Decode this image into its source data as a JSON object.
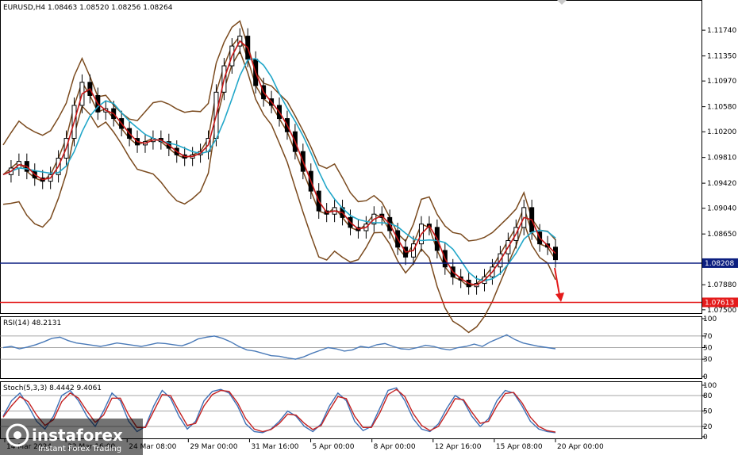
{
  "header": {
    "symbol": "EURUSD,H4",
    "ohlc": "1.08463 1.08520 1.08256 1.08264"
  },
  "chart_data": [
    {
      "type": "candlestick",
      "title": "EURUSD,H4",
      "y_ticks": [
        "1.11740",
        "1.11350",
        "1.10970",
        "1.10580",
        "1.10200",
        "1.09810",
        "1.09420",
        "1.09040",
        "1.08650",
        "1.07880",
        "1.07500"
      ],
      "ylim": [
        1.0745,
        1.1215
      ],
      "x_ticks": [
        "14 Mar 2024",
        "22 Mar 16:00",
        "24 Mar 08:00",
        "29 Mar 00:00",
        "31 Mar 16:00",
        "5 Apr 00:00",
        "8 Apr 00:00",
        "12 Apr 16:00",
        "15 Apr 08:00",
        "20 Apr 00:00"
      ],
      "indicators": [
        "Bollinger Bands",
        "Moving Average (red)",
        "Moving Average (cyan)"
      ],
      "levels": [
        {
          "name": "current-price",
          "value": 1.08208,
          "label": "1.08208",
          "color": "#0c1f80"
        },
        {
          "name": "target-level",
          "value": 1.07613,
          "label": "1.07613",
          "color": "#e41a1a"
        }
      ],
      "close_path": [
        [
          0,
          1.0955
        ],
        [
          1,
          1.0965
        ],
        [
          2,
          1.0975
        ],
        [
          3,
          1.096
        ],
        [
          4,
          1.095
        ],
        [
          5,
          1.0945
        ],
        [
          6,
          1.0955
        ],
        [
          7,
          1.098
        ],
        [
          8,
          1.101
        ],
        [
          9,
          1.106
        ],
        [
          10,
          1.1095
        ],
        [
          11,
          1.1075
        ],
        [
          12,
          1.105
        ],
        [
          13,
          1.1055
        ],
        [
          14,
          1.104
        ],
        [
          15,
          1.1025
        ],
        [
          16,
          1.101
        ],
        [
          17,
          1.1
        ],
        [
          18,
          1.1005
        ],
        [
          19,
          1.101
        ],
        [
          20,
          1.1005
        ],
        [
          21,
          1.0995
        ],
        [
          22,
          1.0985
        ],
        [
          23,
          1.098
        ],
        [
          24,
          1.0985
        ],
        [
          25,
          1.099
        ],
        [
          26,
          1.101
        ],
        [
          27,
          1.108
        ],
        [
          28,
          1.112
        ],
        [
          29,
          1.115
        ],
        [
          30,
          1.1165
        ],
        [
          31,
          1.113
        ],
        [
          32,
          1.109
        ],
        [
          33,
          1.107
        ],
        [
          34,
          1.106
        ],
        [
          35,
          1.104
        ],
        [
          36,
          1.102
        ],
        [
          37,
          1.099
        ],
        [
          38,
          1.096
        ],
        [
          39,
          1.093
        ],
        [
          40,
          1.09
        ],
        [
          41,
          1.0895
        ],
        [
          42,
          1.0905
        ],
        [
          43,
          1.089
        ],
        [
          44,
          1.0875
        ],
        [
          45,
          1.087
        ],
        [
          46,
          1.088
        ],
        [
          47,
          1.0895
        ],
        [
          48,
          1.089
        ],
        [
          49,
          1.087
        ],
        [
          50,
          1.0845
        ],
        [
          51,
          1.083
        ],
        [
          52,
          1.085
        ],
        [
          53,
          1.088
        ],
        [
          54,
          1.0875
        ],
        [
          55,
          1.084
        ],
        [
          56,
          1.0815
        ],
        [
          57,
          1.08
        ],
        [
          58,
          1.0795
        ],
        [
          59,
          1.0785
        ],
        [
          60,
          1.079
        ],
        [
          61,
          1.08
        ],
        [
          62,
          1.0815
        ],
        [
          63,
          1.0835
        ],
        [
          64,
          1.0855
        ],
        [
          65,
          1.0875
        ],
        [
          66,
          1.0905
        ],
        [
          67,
          1.0868
        ],
        [
          68,
          1.085
        ],
        [
          69,
          1.0845
        ],
        [
          70,
          1.0826
        ]
      ]
    },
    {
      "type": "line",
      "title": "RSI(14) 48.2131",
      "y_ticks": [
        "100",
        "70",
        "50",
        "30",
        "0"
      ],
      "ylim": [
        0,
        100
      ],
      "levels": [
        70,
        50,
        30
      ],
      "series": [
        {
          "values": [
            50,
            52,
            48,
            51,
            55,
            60,
            66,
            68,
            62,
            58,
            56,
            54,
            52,
            55,
            58,
            56,
            54,
            52,
            55,
            58,
            57,
            55,
            53,
            58,
            65,
            68,
            70,
            66,
            60,
            52,
            46,
            44,
            40,
            36,
            35,
            32,
            30,
            34,
            40,
            45,
            50,
            48,
            44,
            46,
            52,
            50,
            55,
            57,
            52,
            48,
            47,
            50,
            54,
            52,
            48,
            46,
            50,
            52,
            56,
            52,
            60,
            66,
            72,
            64,
            58,
            55,
            52,
            50,
            48
          ]
        }
      ]
    },
    {
      "type": "line",
      "title": "Stoch(5,3,3) 8.4442 9.4061",
      "y_ticks": [
        "100",
        "80",
        "50",
        "20",
        "0"
      ],
      "ylim": [
        0,
        100
      ],
      "levels": [
        80,
        50,
        20
      ],
      "series": [
        {
          "name": "%K",
          "color": "#3d6fb5",
          "values": [
            40,
            70,
            85,
            60,
            30,
            15,
            40,
            80,
            90,
            70,
            40,
            20,
            50,
            85,
            70,
            30,
            10,
            20,
            60,
            90,
            75,
            40,
            15,
            30,
            70,
            88,
            92,
            85,
            60,
            25,
            10,
            8,
            15,
            30,
            50,
            40,
            20,
            10,
            25,
            60,
            85,
            70,
            30,
            12,
            20,
            55,
            90,
            95,
            70,
            35,
            15,
            10,
            25,
            55,
            80,
            70,
            40,
            20,
            35,
            70,
            90,
            85,
            60,
            30,
            15,
            10,
            8
          ]
        },
        {
          "name": "%D",
          "color": "#c42222",
          "values": [
            38,
            60,
            78,
            68,
            42,
            22,
            33,
            68,
            85,
            75,
            50,
            28,
            42,
            75,
            75,
            42,
            18,
            18,
            50,
            82,
            80,
            50,
            22,
            26,
            60,
            82,
            90,
            88,
            66,
            35,
            15,
            10,
            14,
            26,
            44,
            42,
            26,
            14,
            22,
            52,
            78,
            74,
            40,
            18,
            18,
            46,
            82,
            92,
            78,
            45,
            22,
            12,
            20,
            46,
            74,
            72,
            48,
            26,
            30,
            60,
            84,
            86,
            66,
            38,
            20,
            12,
            9
          ]
        }
      ]
    }
  ],
  "rsi_label": "RSI(14) 48.2131",
  "stoch_label": "Stoch(5,3,3) 8.4442 9.4061",
  "watermark": {
    "brand": "instaforex",
    "tagline": "Instant Forex Trading"
  },
  "colors": {
    "candle": "#000000",
    "bb": "#7a4a1e",
    "ma_red": "#c41414",
    "ma_cyan": "#22a7c9",
    "rsi": "#4a7ab8",
    "current_price": "#0c1f80",
    "target_level": "#e41a1a",
    "arrow": "#e41a1a"
  }
}
